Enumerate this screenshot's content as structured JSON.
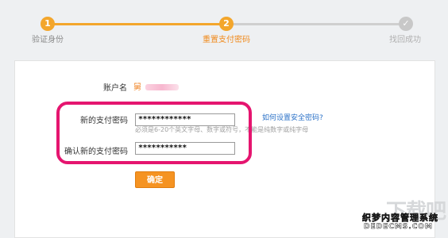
{
  "steps": [
    {
      "number": "1",
      "label": "验证身份"
    },
    {
      "number": "2",
      "label": "重置支付密码"
    },
    {
      "number": "✓",
      "label": "找回成功"
    }
  ],
  "form": {
    "account_label": "账户名",
    "account_value": "舅",
    "new_password_label": "新的支付密码",
    "new_password_value": "************",
    "confirm_password_label": "确认新的支付密码",
    "confirm_password_value": "***********",
    "hint": "必须是6-20个英文字母、数字或符号，不能是纯数字或纯字母",
    "help_link": "如何设置安全密码?",
    "submit_label": "确定"
  },
  "watermark": {
    "logo": "下载吧",
    "text": "织梦内容管理系统",
    "url": "DEDECMS.COM"
  },
  "colors": {
    "accent": "#f3a62c",
    "highlight": "#e5156f",
    "link": "#2d73c8"
  }
}
